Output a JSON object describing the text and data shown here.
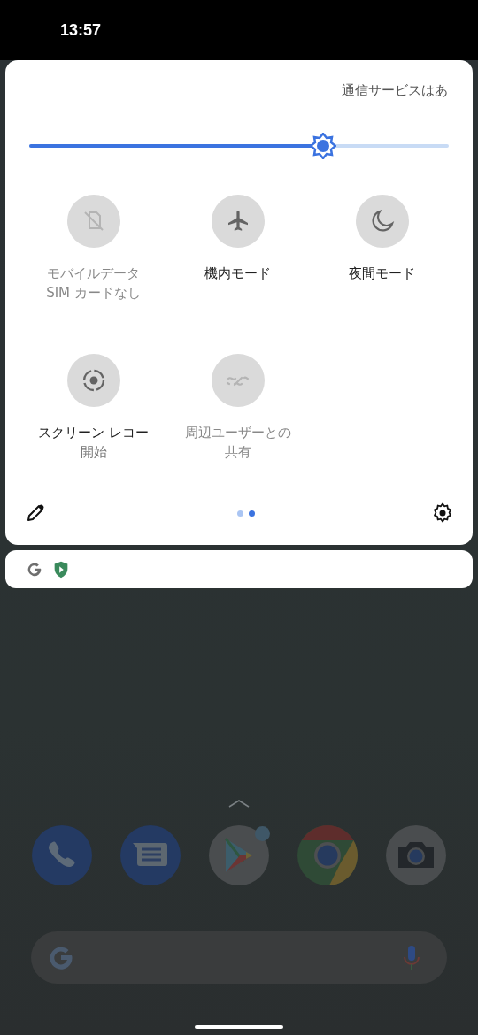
{
  "status_bar": {
    "time": "13:57"
  },
  "quick_settings": {
    "carrier": "通信サービスはあ",
    "brightness": {
      "level": 0.7
    },
    "tiles": [
      {
        "kind": "mobile-data",
        "label": "モバイルデータ",
        "secondary": "SIM カードなし",
        "disabled": true
      },
      {
        "kind": "airplane",
        "label": "機内モード",
        "disabled": false
      },
      {
        "kind": "night",
        "label": "夜間モード",
        "disabled": false
      },
      {
        "kind": "screen-record",
        "label": "スクリーン レコー",
        "secondary": "開始",
        "disabled": false
      },
      {
        "kind": "nearby-share",
        "label": "周辺ユーザーとの",
        "secondary": "共有",
        "disabled": true
      }
    ],
    "pages": [
      {
        "selected": false
      },
      {
        "selected": true
      }
    ]
  },
  "media_bar": {
    "icons": [
      {
        "kind": "google"
      },
      {
        "kind": "shield"
      }
    ]
  },
  "dock": {
    "apps": [
      {
        "kind": "phone",
        "badge": false
      },
      {
        "kind": "messages",
        "badge": false
      },
      {
        "kind": "play",
        "badge": true
      },
      {
        "kind": "chrome",
        "badge": false
      },
      {
        "kind": "camera",
        "badge": false
      }
    ]
  },
  "search_bar": {
    "kind": "google"
  }
}
